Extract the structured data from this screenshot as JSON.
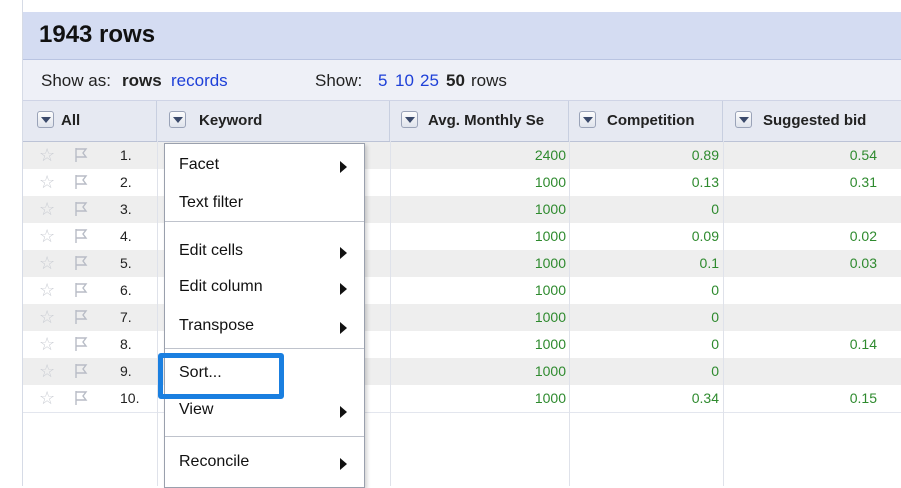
{
  "title": "1943 rows",
  "show_bar": {
    "show_as_label": "Show as:",
    "mode_rows": "rows",
    "mode_records": "records",
    "show_label": "Show:",
    "page_sizes": [
      "5",
      "10",
      "25",
      "50"
    ],
    "selected_page_size": "50",
    "rows_suffix": "rows"
  },
  "columns": [
    {
      "label": "All"
    },
    {
      "label": "Keyword"
    },
    {
      "label": "Avg. Monthly Se"
    },
    {
      "label": "Competition"
    },
    {
      "label": "Suggested bid"
    }
  ],
  "rows": [
    {
      "index": "1.",
      "avg": "2400",
      "competition": "0.89",
      "bid": "0.54"
    },
    {
      "index": "2.",
      "avg": "1000",
      "competition": "0.13",
      "bid": "0.31"
    },
    {
      "index": "3.",
      "avg": "1000",
      "competition": "0",
      "bid": ""
    },
    {
      "index": "4.",
      "avg": "1000",
      "competition": "0.09",
      "bid": "0.02"
    },
    {
      "index": "5.",
      "avg": "1000",
      "competition": "0.1",
      "bid": "0.03"
    },
    {
      "index": "6.",
      "avg": "1000",
      "competition": "0",
      "bid": ""
    },
    {
      "index": "7.",
      "avg": "1000",
      "competition": "0",
      "bid": ""
    },
    {
      "index": "8.",
      "avg": "1000",
      "competition": "0",
      "bid": "0.14"
    },
    {
      "index": "9.",
      "avg": "1000",
      "competition": "0",
      "bid": ""
    },
    {
      "index": "10.",
      "avg": "1000",
      "competition": "0.34",
      "bid": "0.15"
    }
  ],
  "menu": {
    "items": [
      {
        "label": "Facet",
        "submenu": true
      },
      {
        "label": "Text filter",
        "submenu": false
      },
      {
        "label": "Edit cells",
        "submenu": true
      },
      {
        "label": "Edit column",
        "submenu": true
      },
      {
        "label": "Transpose",
        "submenu": true
      },
      {
        "label": "Sort...",
        "submenu": false
      },
      {
        "label": "View",
        "submenu": true
      },
      {
        "label": "Reconcile",
        "submenu": true
      }
    ],
    "highlighted": "Sort..."
  },
  "colors": {
    "title_bar": "#d4dcf2",
    "link": "#1e40d8",
    "numbers": "#2e8a2e",
    "highlight": "#1a7fe0"
  },
  "icons": {
    "star": "star-icon",
    "flag": "flag-icon",
    "dropdown": "dropdown-arrow-icon",
    "submenu": "submenu-arrow-icon"
  }
}
